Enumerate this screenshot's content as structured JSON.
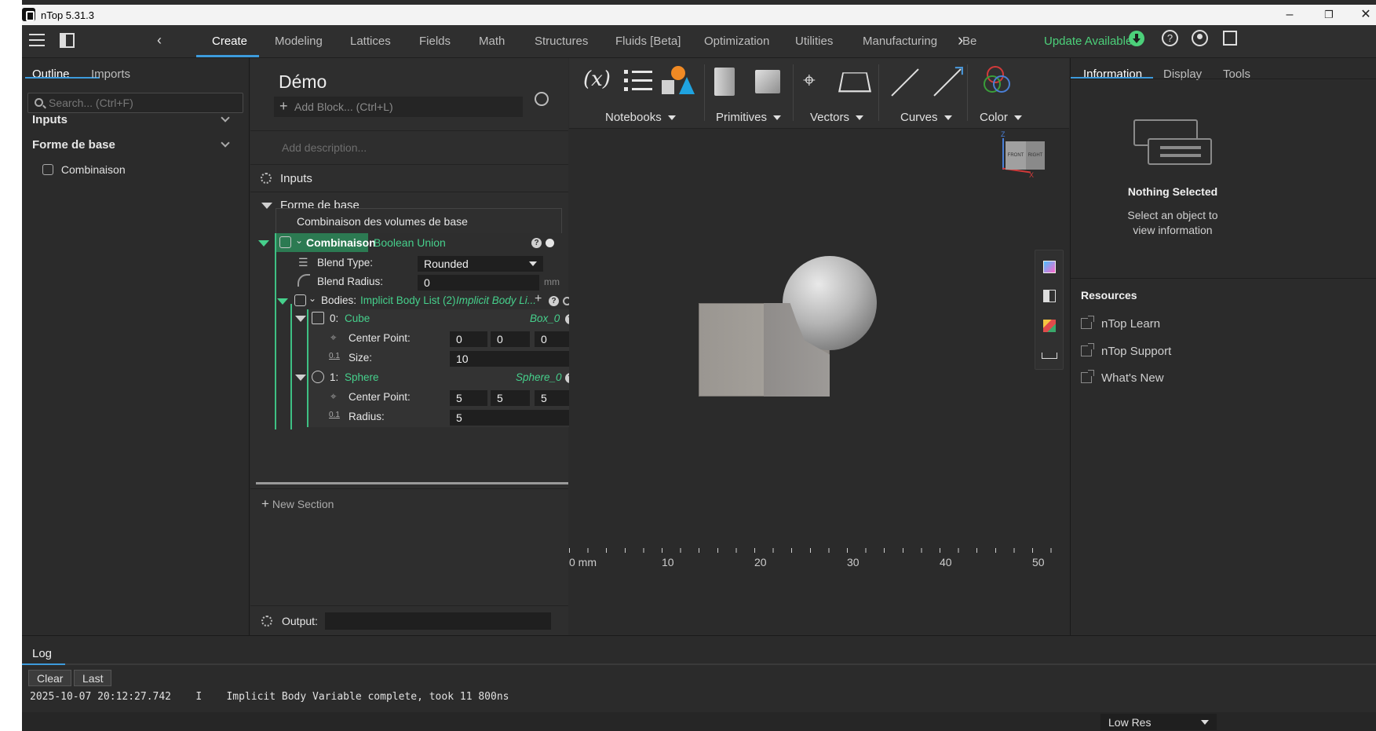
{
  "window": {
    "title": "nTop 5.31.3",
    "minimize": "–",
    "restore": "❐",
    "close": "✕"
  },
  "menubar": {
    "tabs": [
      "Create",
      "Modeling",
      "Lattices",
      "Fields",
      "Math",
      "Structures",
      "Fluids [Beta]",
      "Optimization",
      "Utilities",
      "Manufacturing",
      "Be"
    ],
    "active_tab": "Create",
    "update_label": "Update Available"
  },
  "left_panel": {
    "tabs": [
      "Outline",
      "Imports"
    ],
    "search_placeholder": "Search... (Ctrl+F)",
    "sections": [
      {
        "label": "Inputs"
      },
      {
        "label": "Forme de base",
        "items": [
          "Combinaison"
        ]
      }
    ]
  },
  "notebook": {
    "title": "Démo",
    "add_block_placeholder": "Add Block... (Ctrl+L)",
    "description_placeholder": "Add description...",
    "inputs_label": "Inputs",
    "section_label": "Forme de base",
    "block_comment": "Combinaison des volumes de base",
    "block": {
      "name": "Combinaison",
      "type": "Boolean Union",
      "blend_type_label": "Blend Type:",
      "blend_type_value": "Rounded",
      "blend_radius_label": "Blend Radius:",
      "blend_radius_value": "0",
      "unit": "mm",
      "bodies_label": "Bodies:",
      "bodies_type": "Implicit Body List (2)",
      "bodies_var": "Implicit Body Li...",
      "items": [
        {
          "index": "0:",
          "name": "Cube",
          "var": "Box_0",
          "p1_label": "Center Point:",
          "p1_values": [
            "0",
            "0",
            "0"
          ],
          "p2_label": "Size:",
          "p2_value": "10",
          "p2_icon": "0.1"
        },
        {
          "index": "1:",
          "name": "Sphere",
          "var": "Sphere_0",
          "p1_label": "Center Point:",
          "p1_values": [
            "5",
            "5",
            "5"
          ],
          "p2_label": "Radius:",
          "p2_value": "5",
          "p2_icon": "0.1"
        }
      ]
    },
    "new_section": "New Section",
    "output_label": "Output:"
  },
  "toolbar": {
    "groups": [
      "Notebooks",
      "Primitives",
      "Vectors",
      "Curves",
      "Color"
    ],
    "var_icon": "(x)"
  },
  "viewcube": {
    "front": "FRONT",
    "right": "RIGHT",
    "z": "Z",
    "x": "X"
  },
  "ruler": {
    "labels": [
      "0 mm",
      "10",
      "20",
      "30",
      "40",
      "50"
    ]
  },
  "right_panel": {
    "tabs": [
      "Information",
      "Display",
      "Tools"
    ],
    "nothing_selected": "Nothing Selected",
    "hint": "Select an object to view information",
    "resources_title": "Resources",
    "links": [
      "nTop Learn",
      "nTop Support",
      "What's New"
    ]
  },
  "log": {
    "tab": "Log",
    "clear": "Clear",
    "last": "Last",
    "entry": "2025-10-07 20:12:27.742    I    Implicit Body Variable complete, took 11 800ns",
    "resolution": "Low Res"
  },
  "colors": {
    "accent": "#3d9bdc",
    "green": "#46d08c",
    "update": "#4cd07a",
    "bg": "#2b2b2b"
  }
}
